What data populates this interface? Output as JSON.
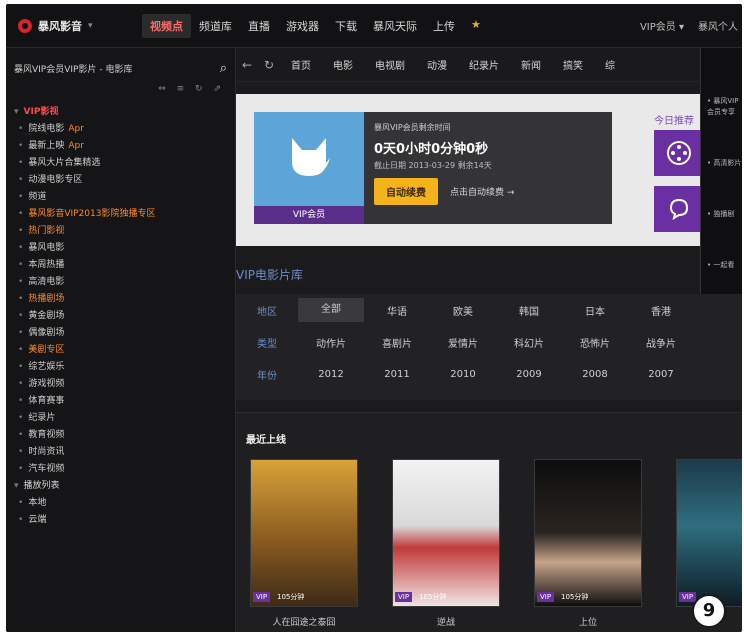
{
  "app": {
    "logo_text": "暴风影音",
    "logo_caret": "▾"
  },
  "top_nav": {
    "items": [
      {
        "label": "视频点",
        "active": true
      },
      {
        "label": "频道库",
        "active": false
      },
      {
        "label": "直播",
        "active": false
      },
      {
        "label": "游戏器",
        "active": false
      },
      {
        "label": "下载",
        "active": false
      },
      {
        "label": "暴风天际",
        "active": false
      },
      {
        "label": "上传",
        "active": false
      }
    ],
    "star": "★",
    "right": [
      "VIP会员 ▾",
      "暴风个人"
    ]
  },
  "sidebar": {
    "search_value": "暴风VIP会员VIP影片 - 电影库",
    "tools": "⇔ ≡ ↻ ⇗",
    "items": [
      {
        "label": "VIP影视",
        "style": "group",
        "tag": ""
      },
      {
        "label": "院线电影",
        "style": "normal",
        "tag": "Apr"
      },
      {
        "label": "最新上映",
        "style": "normal",
        "tag": "Apr"
      },
      {
        "label": "暴风大片合集精选",
        "style": "normal",
        "tag": ""
      },
      {
        "label": "动漫电影专区",
        "style": "normal",
        "tag": ""
      },
      {
        "label": "频道",
        "style": "normal",
        "tag": ""
      },
      {
        "label": "暴风影音VIP2013影院独播专区",
        "style": "orange",
        "tag": ""
      },
      {
        "label": "热门影视",
        "style": "orange",
        "tag": ""
      },
      {
        "label": "暴风电影",
        "style": "normal",
        "tag": ""
      },
      {
        "label": "本周热播",
        "style": "normal",
        "tag": ""
      },
      {
        "label": "高清电影",
        "style": "normal",
        "tag": ""
      },
      {
        "label": "热播剧场",
        "style": "orange",
        "tag": ""
      },
      {
        "label": "黄金剧场",
        "style": "normal",
        "tag": ""
      },
      {
        "label": "偶像剧场",
        "style": "normal",
        "tag": ""
      },
      {
        "label": "美剧专区",
        "style": "orange",
        "tag": ""
      },
      {
        "label": "综艺娱乐",
        "style": "normal",
        "tag": ""
      },
      {
        "label": "游戏视频",
        "style": "normal",
        "tag": ""
      },
      {
        "label": "体育赛事",
        "style": "normal",
        "tag": ""
      },
      {
        "label": "纪录片",
        "style": "normal",
        "tag": ""
      },
      {
        "label": "教育视频",
        "style": "normal",
        "tag": ""
      },
      {
        "label": "时尚资讯",
        "style": "normal",
        "tag": ""
      },
      {
        "label": "汽车视频",
        "style": "normal",
        "tag": ""
      },
      {
        "label": "播放列表",
        "style": "plain-group",
        "tag": ""
      },
      {
        "label": "本地",
        "style": "normal",
        "tag": ""
      },
      {
        "label": "云端",
        "style": "normal",
        "tag": ""
      }
    ]
  },
  "browser": {
    "back": "←",
    "refresh": "↻",
    "categories": [
      "首页",
      "电影",
      "电视剧",
      "动漫",
      "纪录片",
      "新闻",
      "搞笑",
      "综"
    ]
  },
  "vip_card": {
    "brand": "VIP会员",
    "line1": "暴风VIP会员剩余时间",
    "remaining": "0天0小时0分钟0秒",
    "expiry": "截止日期 2013-03-29 剩余14天",
    "renew_button": "自动续费",
    "renew_link": "点击自动续费 →"
  },
  "side_promo": {
    "title": "今日推荐"
  },
  "overlay": {
    "items": [
      "• 暴风VIP会员专享",
      "• 高清影片",
      "• 独播剧",
      "• 一起看"
    ]
  },
  "vip_section": {
    "title": "VIP电影片库",
    "filters": {
      "region": {
        "label": "地区",
        "options": [
          "全部",
          "华语",
          "欧美",
          "韩国",
          "日本",
          "香港"
        ],
        "selected": "全部"
      },
      "genre": {
        "label": "类型",
        "options": [
          "动作片",
          "喜剧片",
          "爱情片",
          "科幻片",
          "恐怖片",
          "战争片"
        ]
      },
      "year": {
        "label": "年份",
        "options": [
          "2012",
          "2011",
          "2010",
          "2009",
          "2008",
          "2007"
        ]
      }
    }
  },
  "recent": {
    "title": "最近上线",
    "movies": [
      {
        "title": "人在囧途之泰囧",
        "badge": "VIP",
        "time": "105分钟"
      },
      {
        "title": "逆战",
        "badge": "VIP",
        "time": "105分钟"
      },
      {
        "title": "上位",
        "badge": "VIP",
        "time": "105分钟"
      },
      {
        "title": "",
        "badge": "VIP",
        "time": ""
      }
    ]
  },
  "page_badge": "9"
}
